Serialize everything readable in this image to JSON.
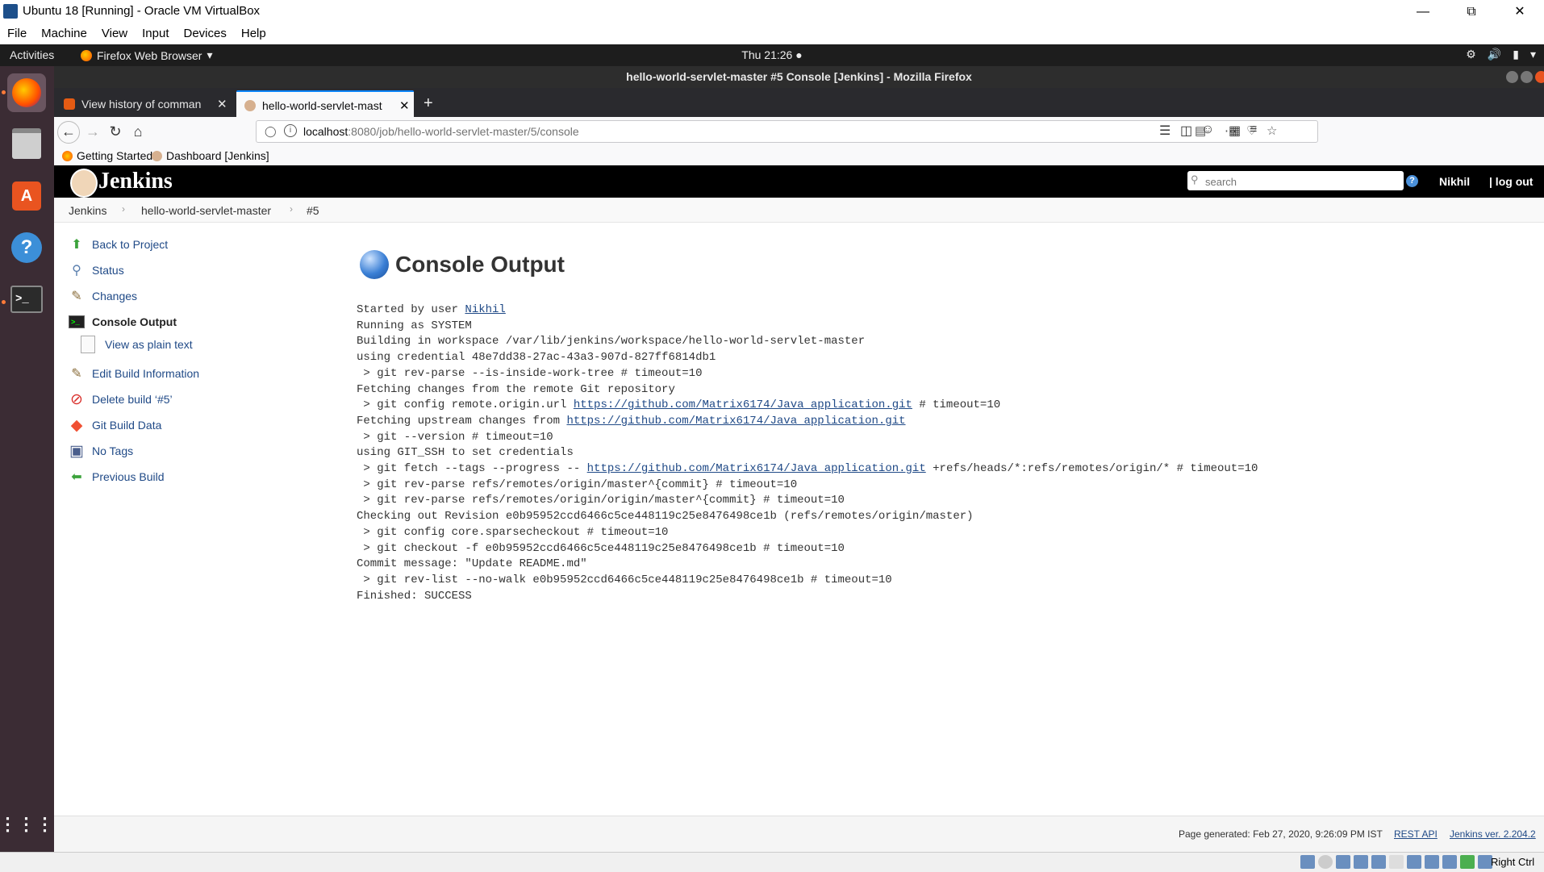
{
  "vbox": {
    "title": "Ubuntu 18 [Running] - Oracle VM VirtualBox",
    "menu": [
      "File",
      "Machine",
      "View",
      "Input",
      "Devices",
      "Help"
    ],
    "host_key": "Right Ctrl"
  },
  "gnome": {
    "activities": "Activities",
    "app_menu": "Firefox Web Browser",
    "clock": "Thu 21:26"
  },
  "firefox": {
    "window_title": "hello-world-servlet-master #5 Console [Jenkins] - Mozilla Firefox",
    "tabs": [
      {
        "label": "View history of comman",
        "active": false
      },
      {
        "label": "hello-world-servlet-mast",
        "active": true
      }
    ],
    "url_host": "localhost",
    "url_path": ":8080/job/hello-world-servlet-master/5/console",
    "bookmarks": [
      "Getting Started",
      "Dashboard [Jenkins]"
    ]
  },
  "jenkins": {
    "brand": "Jenkins",
    "search_placeholder": "search",
    "user": "Nikhil",
    "logout": "| log out",
    "breadcrumbs": [
      "Jenkins",
      "hello-world-servlet-master",
      "#5"
    ],
    "side_panel": [
      {
        "label": "Back to Project",
        "icon": "up-arrow-icon"
      },
      {
        "label": "Status",
        "icon": "magnifier-icon"
      },
      {
        "label": "Changes",
        "icon": "notepad-icon"
      },
      {
        "label": "Console Output",
        "icon": "terminal-icon"
      },
      {
        "label": "View as plain text",
        "icon": "document-icon"
      },
      {
        "label": "Edit Build Information",
        "icon": "notepad-icon"
      },
      {
        "label": "Delete build ‘#5’",
        "icon": "no-entry-icon"
      },
      {
        "label": "Git Build Data",
        "icon": "git-icon"
      },
      {
        "label": "No Tags",
        "icon": "save-icon"
      },
      {
        "label": "Previous Build",
        "icon": "left-arrow-icon"
      }
    ],
    "heading": "Console Output",
    "console": {
      "l1_prefix": "Started by user ",
      "l1_user": "Nikhil",
      "l2": "Running as SYSTEM",
      "l3": "Building in workspace /var/lib/jenkins/workspace/hello-world-servlet-master",
      "l4": "using credential 48e7dd38-27ac-43a3-907d-827ff6814db1",
      "l5": " > git rev-parse --is-inside-work-tree # timeout=10",
      "l6": "Fetching changes from the remote Git repository",
      "l7_prefix": " > git config remote.origin.url ",
      "l7_link": "https://github.com/Matrix6174/Java_application.git",
      "l7_suffix": " # timeout=10",
      "l8_prefix": "Fetching upstream changes from ",
      "l8_link": "https://github.com/Matrix6174/Java_application.git",
      "l9": " > git --version # timeout=10",
      "l10": "using GIT_SSH to set credentials",
      "l11_prefix": " > git fetch --tags --progress -- ",
      "l11_link": "https://github.com/Matrix6174/Java_application.git",
      "l11_suffix": " +refs/heads/*:refs/remotes/origin/* # timeout=10",
      "l12": " > git rev-parse refs/remotes/origin/master^{commit} # timeout=10",
      "l13": " > git rev-parse refs/remotes/origin/origin/master^{commit} # timeout=10",
      "l14": "Checking out Revision e0b95952ccd6466c5ce448119c25e8476498ce1b (refs/remotes/origin/master)",
      "l15": " > git config core.sparsecheckout # timeout=10",
      "l16": " > git checkout -f e0b95952ccd6466c5ce448119c25e8476498ce1b # timeout=10",
      "l17": "Commit message: \"Update README.md\"",
      "l18": " > git rev-list --no-walk e0b95952ccd6466c5ce448119c25e8476498ce1b # timeout=10",
      "l19": "Finished: SUCCESS"
    },
    "footer": {
      "generated": "Page generated: Feb 27, 2020, 9:26:09 PM IST",
      "rest_api": "REST API",
      "version": "Jenkins ver. 2.204.2"
    }
  }
}
